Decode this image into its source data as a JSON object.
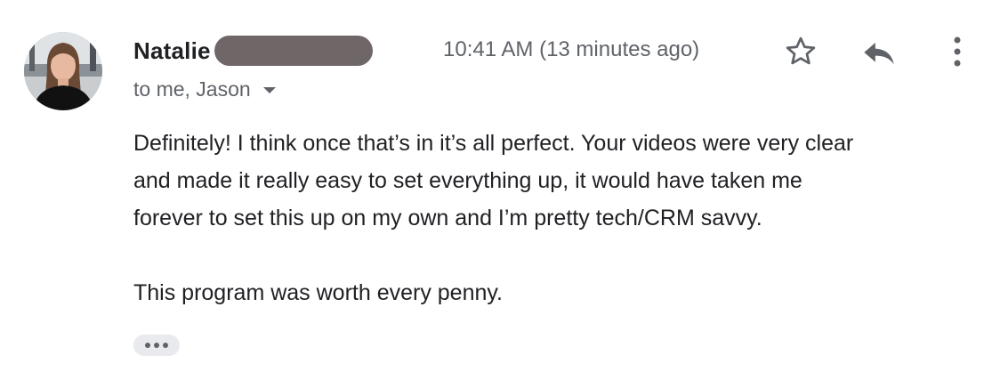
{
  "sender": {
    "name": "Natalie",
    "recipients_text": "to me, Jason"
  },
  "timestamp": "10:41 AM (13 minutes ago)",
  "actions": {
    "star_icon": "star-outline-icon",
    "reply_icon": "reply-arrow-icon",
    "more_icon": "vertical-dots-icon"
  },
  "body": {
    "paragraph1_lines": [
      "Definitely! I think once that’s in it’s all perfect. Your videos were very clear",
      "and made it really easy to set everything up, it would have taken me",
      "forever to set this up on my own and I’m pretty tech/CRM savvy."
    ],
    "paragraph2": "This program was worth every penny."
  },
  "colors": {
    "text_primary": "#202124",
    "text_secondary": "#5f6368",
    "redaction": "#6f6767",
    "pill_bg": "#e8eaed"
  }
}
